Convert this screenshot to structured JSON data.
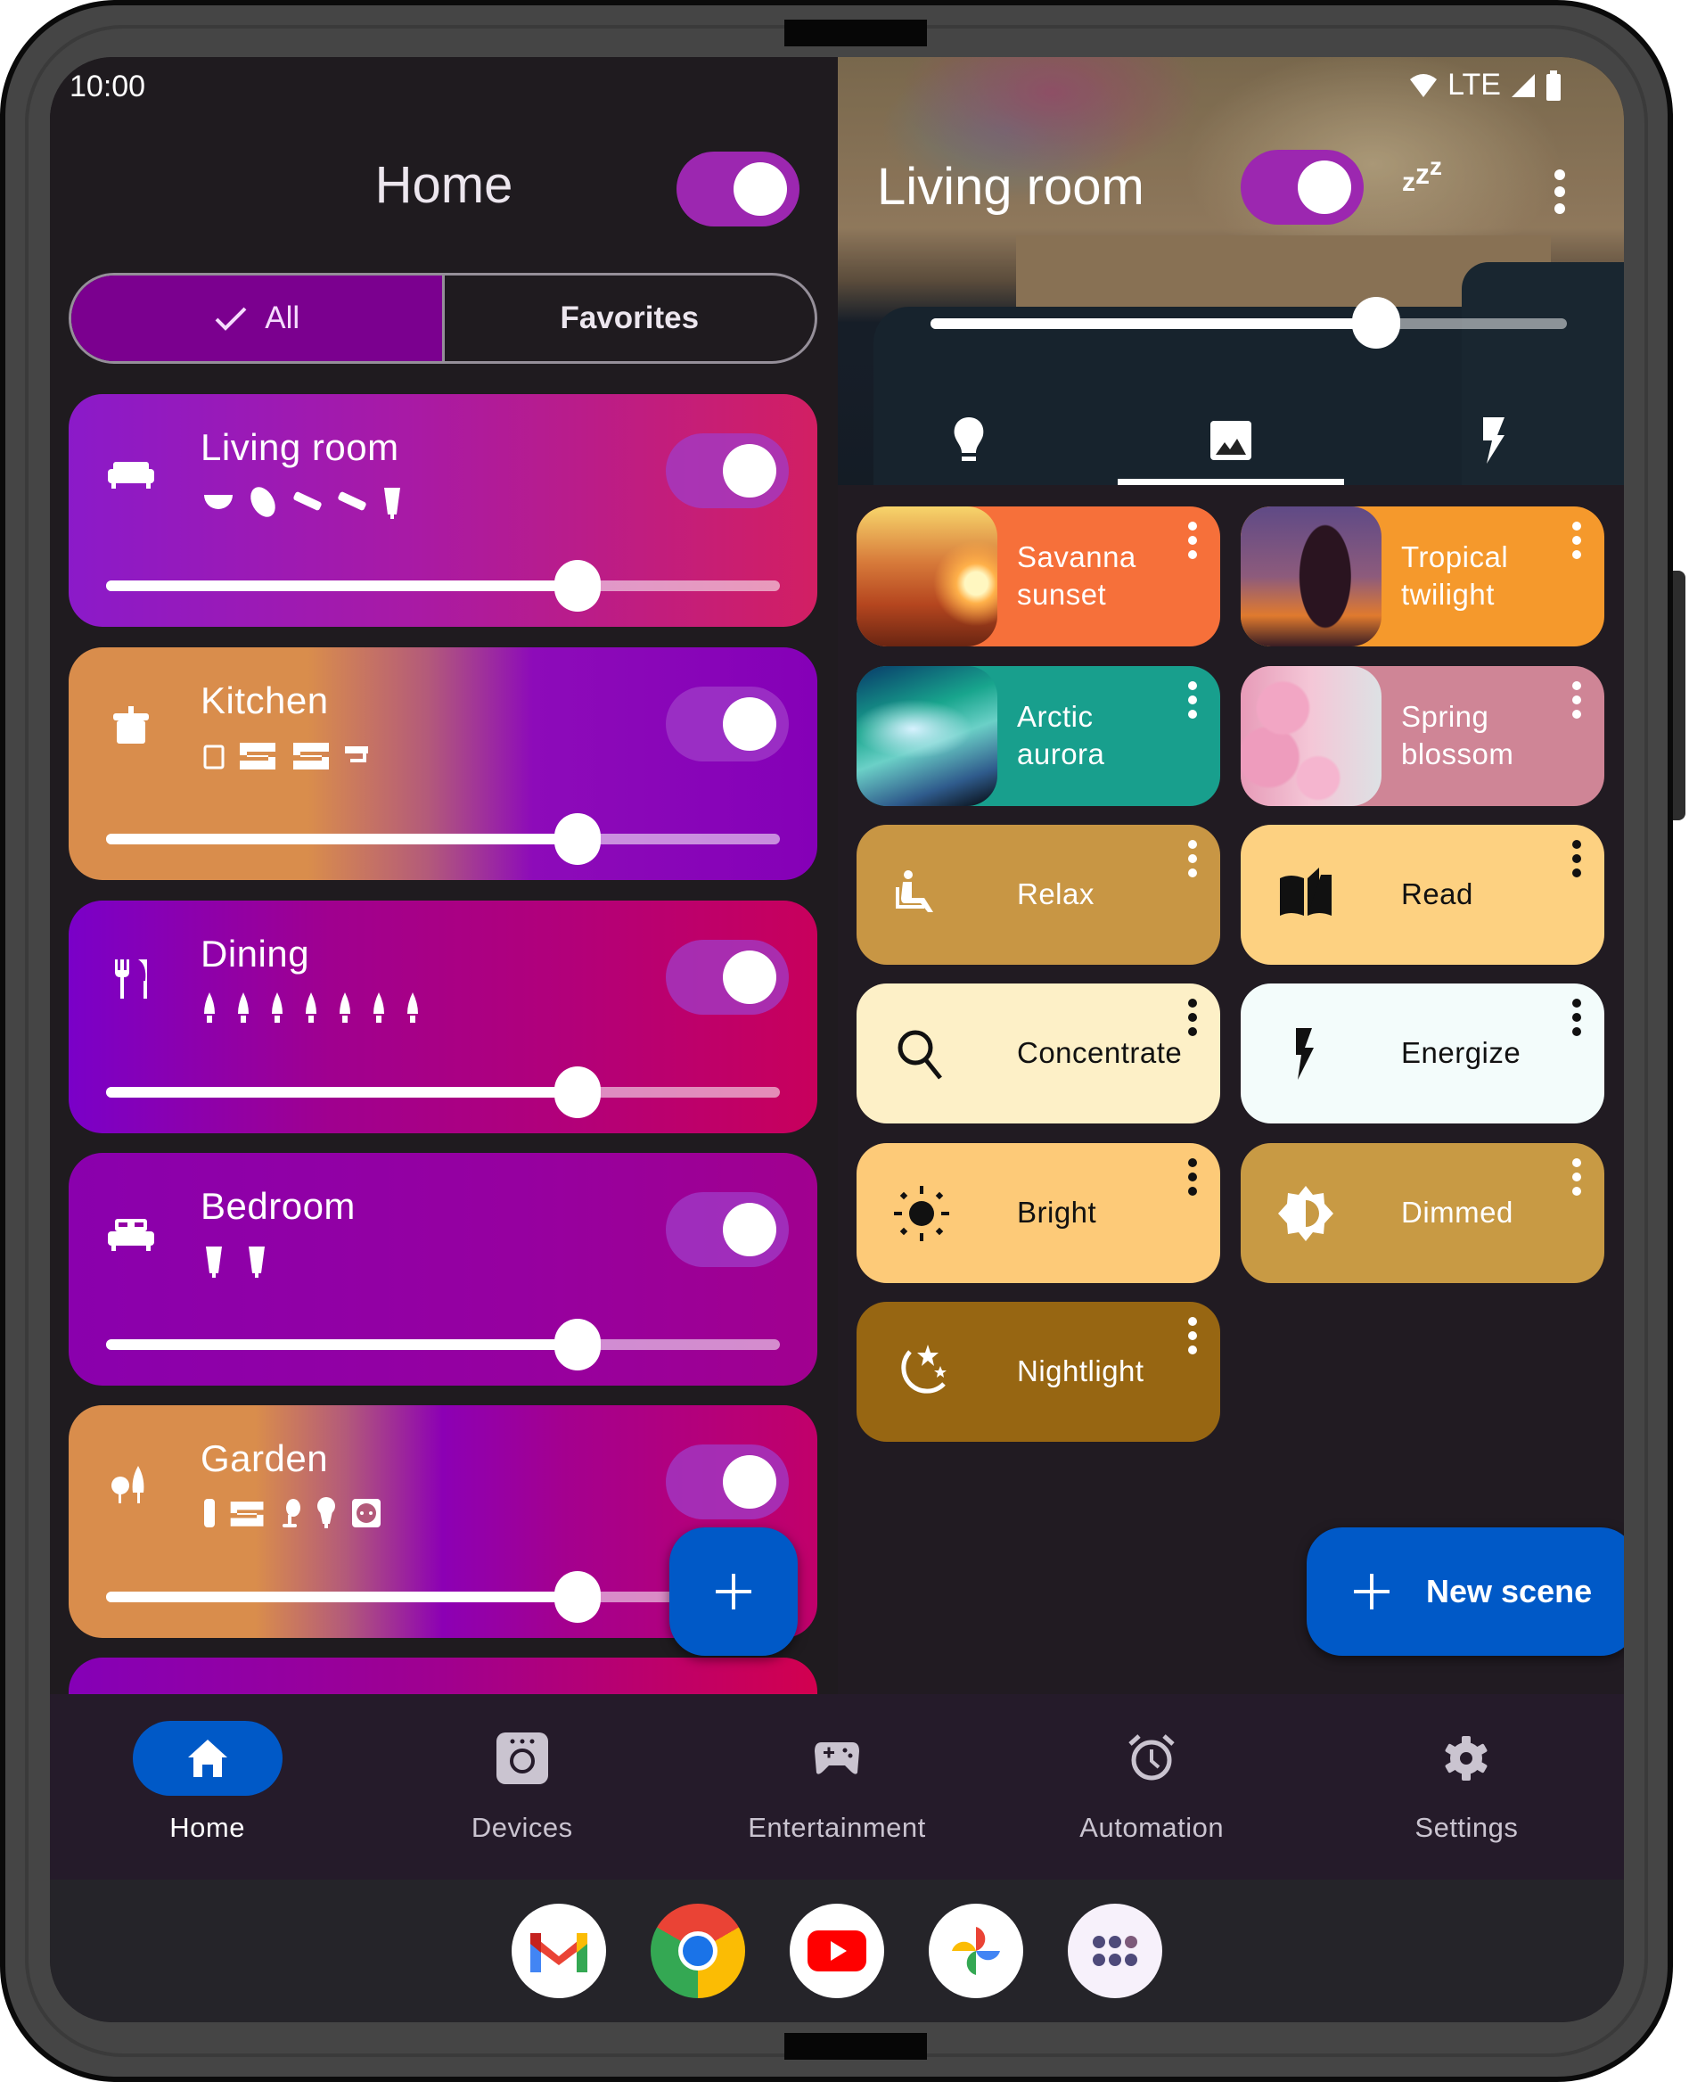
{
  "status_bar": {
    "time": "10:00",
    "network": "LTE",
    "icons": [
      "wifi-icon",
      "signal-icon",
      "battery-icon"
    ]
  },
  "home": {
    "title": "Home",
    "master_toggle_on": true,
    "filter": {
      "options": [
        "All",
        "Favorites"
      ],
      "selected": "All"
    },
    "rooms": [
      {
        "name": "Living room",
        "icon": "sofa-icon",
        "on": true,
        "brightness": 0.7,
        "lights": [
          "bowl-lamp",
          "spot-lamp",
          "lightbar",
          "lightbar",
          "bulb-tall"
        ]
      },
      {
        "name": "Kitchen",
        "icon": "pot-icon",
        "on": true,
        "brightness": 0.7,
        "lights": [
          "panel",
          "lightstrip",
          "lightstrip",
          "strip-end"
        ]
      },
      {
        "name": "Dining",
        "icon": "cutlery-icon",
        "on": true,
        "brightness": 0.7,
        "lights": [
          "candle",
          "candle",
          "candle",
          "candle",
          "candle",
          "candle",
          "candle"
        ]
      },
      {
        "name": "Bedroom",
        "icon": "bed-icon",
        "on": true,
        "brightness": 0.7,
        "lights": [
          "bulb-tall",
          "bulb-tall"
        ]
      },
      {
        "name": "Garden",
        "icon": "trees-icon",
        "on": true,
        "brightness": 0.7,
        "lights": [
          "bollard",
          "lightstrip",
          "spot",
          "bulb",
          "outlet"
        ]
      }
    ],
    "add_button_label": "+"
  },
  "room_detail": {
    "title": "Living room",
    "on": true,
    "brightness": 0.7,
    "tabs": [
      {
        "name": "lights",
        "icon": "lightbulb-icon"
      },
      {
        "name": "scenes",
        "icon": "image-icon",
        "active": true
      },
      {
        "name": "effects",
        "icon": "bolt-icon"
      }
    ],
    "scenes": [
      {
        "label": "Savanna sunset",
        "line1": "Savanna",
        "line2": "sunset",
        "color": "#f6703a",
        "kind": "photo",
        "thumb": "sunset"
      },
      {
        "label": "Tropical twilight",
        "line1": "Tropical",
        "line2": "twilight",
        "color": "#f5992c",
        "kind": "photo",
        "thumb": "palm"
      },
      {
        "label": "Arctic aurora",
        "line1": "Arctic",
        "line2": "aurora",
        "color": "#189f8d",
        "kind": "photo",
        "thumb": "aurora"
      },
      {
        "label": "Spring blossom",
        "line1": "Spring",
        "line2": "blossom",
        "color": "#cf8596",
        "kind": "photo",
        "thumb": "blossom"
      },
      {
        "label": "Relax",
        "color": "#c89644",
        "kind": "icon",
        "icon": "relax-icon",
        "dark": false
      },
      {
        "label": "Read",
        "color": "#fdd181",
        "kind": "icon",
        "icon": "book-icon",
        "dark": true
      },
      {
        "label": "Concentrate",
        "color": "#fdf0c7",
        "kind": "icon",
        "icon": "search-icon",
        "dark": true
      },
      {
        "label": "Energize",
        "color": "#f3fcfb",
        "kind": "icon",
        "icon": "bolt-icon",
        "dark": true
      },
      {
        "label": "Bright",
        "color": "#fdca78",
        "kind": "icon",
        "icon": "sun-icon",
        "dark": true
      },
      {
        "label": "Dimmed",
        "color": "#c89a44",
        "kind": "icon",
        "icon": "brightness-half-icon",
        "dark": false
      },
      {
        "label": "Nightlight",
        "color": "#976612",
        "kind": "icon",
        "icon": "moon-stars-icon",
        "dark": false
      }
    ],
    "new_scene_label": "New scene"
  },
  "bottom_nav": {
    "items": [
      {
        "label": "Home",
        "icon": "home-icon",
        "active": true
      },
      {
        "label": "Devices",
        "icon": "devices-icon"
      },
      {
        "label": "Entertainment",
        "icon": "gamepad-icon"
      },
      {
        "label": "Automation",
        "icon": "alarm-icon"
      },
      {
        "label": "Settings",
        "icon": "gear-icon"
      }
    ]
  },
  "dock": {
    "apps": [
      "Gmail",
      "Chrome",
      "YouTube",
      "Photos",
      "App drawer"
    ]
  },
  "colors": {
    "accent_purple": "#9c27b0",
    "fab_blue": "#0059c7",
    "segment_active": "#7b008f",
    "background": "#1f1b1f"
  }
}
